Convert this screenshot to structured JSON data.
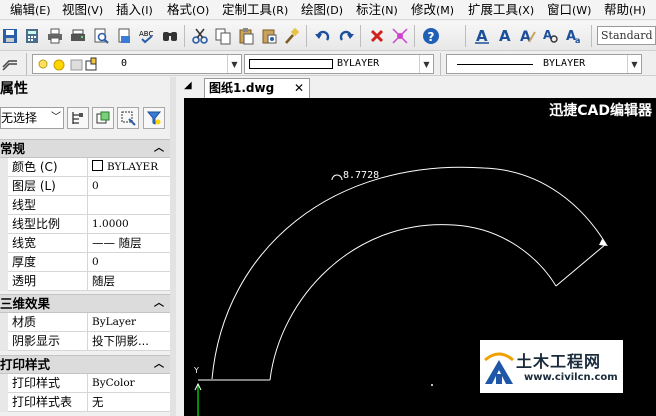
{
  "menus": [
    {
      "label": "编辑",
      "key": "(E)"
    },
    {
      "label": "视图",
      "key": "(V)"
    },
    {
      "label": "插入",
      "key": "(I)"
    },
    {
      "label": "格式",
      "key": "(O)"
    },
    {
      "label": "定制工具",
      "key": "(R)"
    },
    {
      "label": "绘图",
      "key": "(D)"
    },
    {
      "label": "标注",
      "key": "(N)"
    },
    {
      "label": "修改",
      "key": "(M)"
    },
    {
      "label": "扩展工具",
      "key": "(X)"
    },
    {
      "label": "窗口",
      "key": "(W)"
    },
    {
      "label": "帮助",
      "key": "(H)"
    }
  ],
  "toolbar": {
    "text_style": "Standard"
  },
  "layer_bar": {
    "layer_value": "0",
    "color_value": "BYLAYER",
    "linetype_value": "BYLAYER"
  },
  "properties": {
    "title": "属性",
    "selection": "无选择",
    "sections": {
      "general": "常规",
      "effects3d": "三维效果",
      "plot": "打印样式"
    },
    "general_rows": [
      {
        "key": "颜色 (C)",
        "value": "BYLAYER"
      },
      {
        "key": "图层 (L)",
        "value": "0"
      },
      {
        "key": "线型",
        "value": ""
      },
      {
        "key": "线型比例",
        "value": "1.0000"
      },
      {
        "key": "线宽",
        "value": "—— 随层"
      },
      {
        "key": "厚度",
        "value": "0"
      },
      {
        "key": "透明",
        "value": "随层"
      }
    ],
    "effects_rows": [
      {
        "key": "材质",
        "value": "ByLayer"
      },
      {
        "key": "阴影显示",
        "value": "投下阴影..."
      }
    ],
    "plot_rows": [
      {
        "key": "打印样式",
        "value": "ByColor"
      },
      {
        "key": "打印样式表",
        "value": "无"
      }
    ]
  },
  "document": {
    "tab_label": "图纸1.dwg",
    "close_glyph": "✕"
  },
  "canvas": {
    "brand": "迅捷CAD编辑器",
    "dimension": "8.7728",
    "ucs_axis": "Y"
  },
  "watermark": {
    "title": "土木工程网",
    "url": "www.civilcn.com"
  },
  "colors": {
    "canvas": "#000000",
    "drawing": "#ffffff",
    "accent": "#2b5ea8"
  }
}
